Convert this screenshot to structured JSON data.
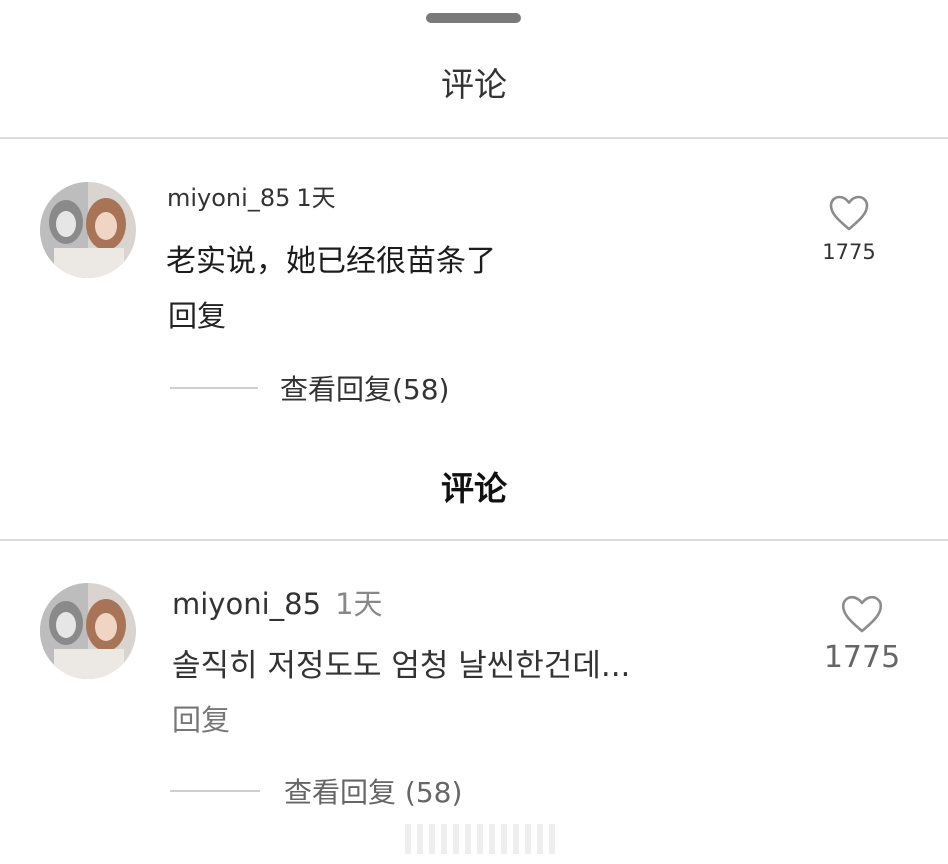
{
  "sections": [
    {
      "title": "评论",
      "comment": {
        "username": "miyoni_85",
        "time": "1天",
        "text": "老实说，她已经很苗条了",
        "reply_label": "回复",
        "view_replies": "查看回复(58)",
        "likes": "1775"
      }
    },
    {
      "title": "评论",
      "comment": {
        "username": "miyoni_85",
        "time": "1天",
        "text": "솔직히 저정도도 엄청 날씬한건데...",
        "reply_label": "回复",
        "view_replies": "查看回复 (58)",
        "likes": "1775"
      }
    }
  ]
}
